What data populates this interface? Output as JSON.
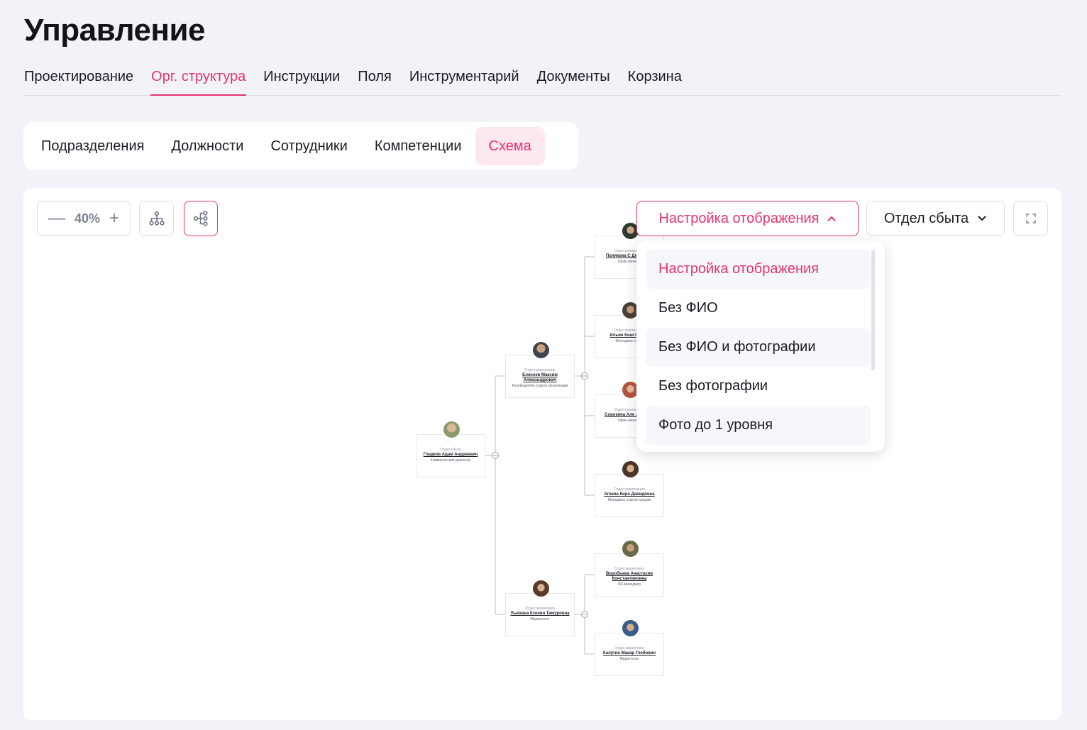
{
  "page": {
    "title": "Управление"
  },
  "main_tabs": [
    {
      "label": "Проектирование"
    },
    {
      "label": "Орг. структура"
    },
    {
      "label": "Инструкции"
    },
    {
      "label": "Поля"
    },
    {
      "label": "Инструментарий"
    },
    {
      "label": "Документы"
    },
    {
      "label": "Корзина"
    }
  ],
  "active_main_tab": "Орг. структура",
  "sub_tabs": [
    {
      "label": "Подразделения"
    },
    {
      "label": "Должности"
    },
    {
      "label": "Сотрудники"
    },
    {
      "label": "Компетенции"
    },
    {
      "label": "Схема"
    }
  ],
  "active_sub_tab": "Схема",
  "toolbar": {
    "zoom_minus": "—",
    "zoom_value": "40%",
    "zoom_plus": "+",
    "settings_label": "Настройка отображения",
    "department_label": "Отдел сбыта"
  },
  "dropdown": {
    "items": [
      {
        "label": "Настройка отображения"
      },
      {
        "label": "Без ФИО"
      },
      {
        "label": "Без ФИО и фотографии"
      },
      {
        "label": "Без фотографии"
      },
      {
        "label": "Фото до 1 уровня"
      }
    ],
    "selected": "Настройка отображения"
  },
  "org_chart": {
    "nodes": [
      {
        "dept": "Отдел сбыта",
        "name": "Гладков Адам Андреевич",
        "role": "Коммерческий директор"
      },
      {
        "dept": "Отдел реализации",
        "name": "Елисеев Максим Александрович",
        "role": "Руководитель отдела реализации"
      },
      {
        "dept": "Отдел маркетинга",
        "name": "Львовна Ксения Тимуровна",
        "role": "Маркетолог"
      },
      {
        "dept": "Отдел реализации",
        "name": "Полякова С Дмитриев",
        "role": "Офис-менедж"
      },
      {
        "dept": "Отдел реализации",
        "name": "Ильин Константин",
        "role": "Менеджер отдел"
      },
      {
        "dept": "Отдел реализации",
        "name": "Сорокина Але Данилов",
        "role": "Офис-менедж"
      },
      {
        "dept": "Отдел реализации",
        "name": "Агеева Кира Давидовна",
        "role": "Менеджер отдела продаж"
      },
      {
        "dept": "Отдел маркетинга",
        "name": "Воробьева Анастасия Константиновна",
        "role": "PR-менеджер"
      },
      {
        "dept": "Отдел маркетинга",
        "name": "Калугин Макар Глебович",
        "role": "Маркетолог"
      }
    ]
  },
  "colors": {
    "accent": "#e8336e",
    "background": "#f1f3f9"
  },
  "icons": {
    "tree": "org-tree-icon",
    "side": "horizontal-tree-icon",
    "fullscreen": "fullscreen-icon",
    "chevron_up": "chevron-up-icon",
    "chevron_down": "chevron-down-icon"
  }
}
